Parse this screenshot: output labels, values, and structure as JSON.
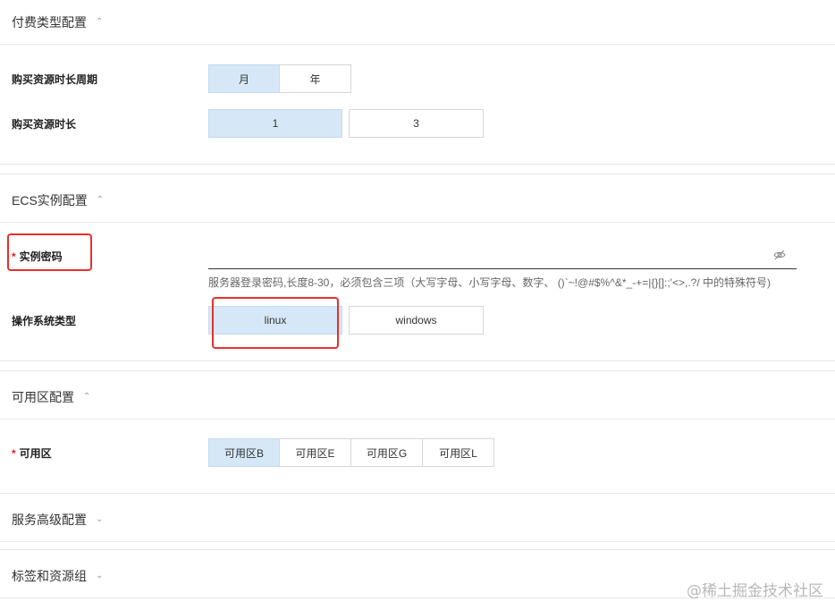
{
  "sections": {
    "billing": {
      "title": "付费类型配置",
      "chevron": "chevron-up-icon"
    },
    "ecs": {
      "title": "ECS实例配置",
      "chevron": "chevron-up-icon"
    },
    "zone": {
      "title": "可用区配置",
      "chevron": "chevron-up-icon"
    },
    "advanced": {
      "title": "服务高级配置",
      "chevron": "chevron-down-icon"
    },
    "tags": {
      "title": "标签和资源组",
      "chevron": "chevron-down-icon"
    }
  },
  "billing": {
    "period_unit_label": "购买资源时长周期",
    "period_unit_options": [
      "月",
      "年"
    ],
    "period_unit_selected": "月",
    "duration_label": "购买资源时长",
    "duration_options": [
      "1",
      "3"
    ],
    "duration_selected": "1"
  },
  "ecs": {
    "password_label": "实例密码",
    "password_required": "*",
    "password_value": "",
    "password_hint": "服务器登录密码,长度8-30，必须包含三项（大写字母、小写字母、数字、 ()`~!@#$%^&*_-+=|{}[]:;'<>,.?/ 中的特殊符号)",
    "os_label": "操作系统类型",
    "os_options": [
      "linux",
      "windows"
    ],
    "os_selected": "linux"
  },
  "zone": {
    "label": "可用区",
    "required": "*",
    "options": [
      "可用区B",
      "可用区E",
      "可用区G",
      "可用区L"
    ],
    "selected": "可用区B"
  },
  "watermark": "@稀土掘金技术社区",
  "colors": {
    "selected_bg": "#d6e8f8",
    "highlight_box": "#e8302c",
    "required": "#e02020"
  }
}
